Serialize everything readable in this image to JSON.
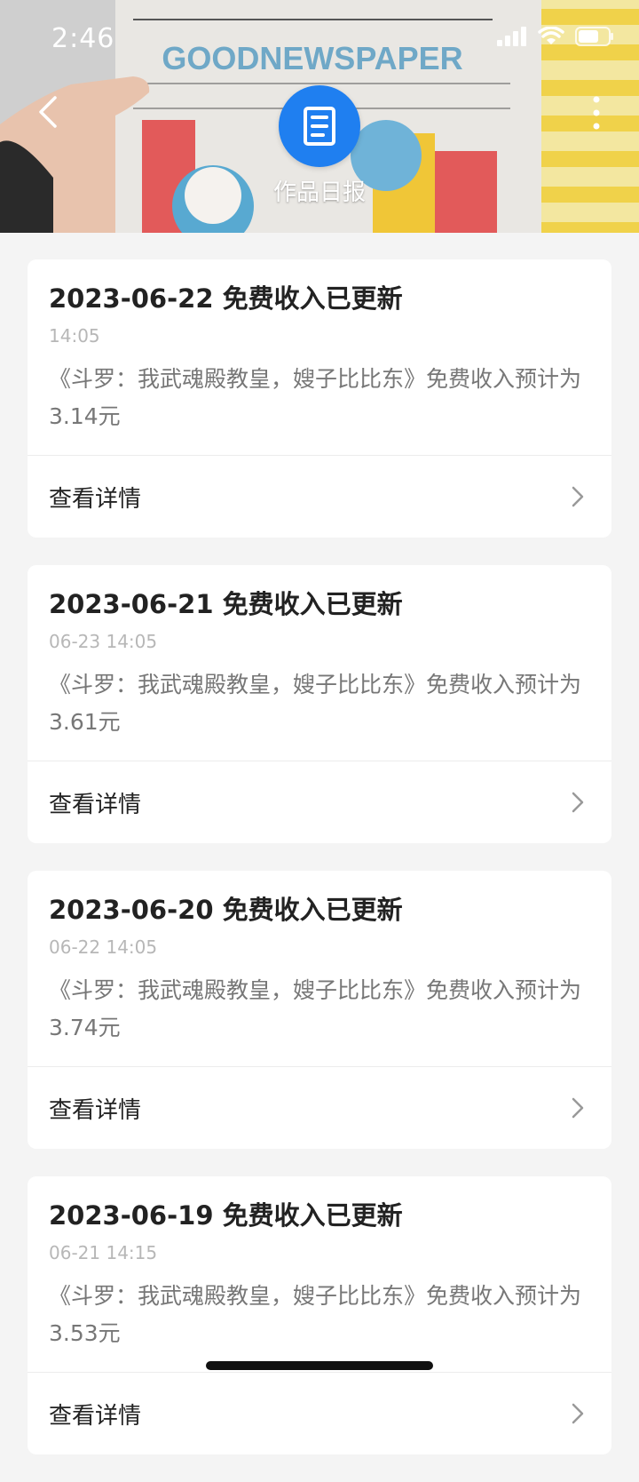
{
  "status": {
    "time": "2:46"
  },
  "header": {
    "banner_text": "GOODNEWSPAPER",
    "title": "作品日报"
  },
  "cards": [
    {
      "title": "2023-06-22 免费收入已更新",
      "time": "14:05",
      "desc": "《斗罗：我武魂殿教皇，嫂子比比东》免费收入预计为3.14元",
      "action": "查看详情"
    },
    {
      "title": "2023-06-21 免费收入已更新",
      "time": "06-23 14:05",
      "desc": "《斗罗：我武魂殿教皇，嫂子比比东》免费收入预计为3.61元",
      "action": "查看详情"
    },
    {
      "title": "2023-06-20 免费收入已更新",
      "time": "06-22 14:05",
      "desc": "《斗罗：我武魂殿教皇，嫂子比比东》免费收入预计为3.74元",
      "action": "查看详情"
    },
    {
      "title": "2023-06-19 免费收入已更新",
      "time": "06-21 14:15",
      "desc": "《斗罗：我武魂殿教皇，嫂子比比东》免费收入预计为3.53元",
      "action": "查看详情"
    }
  ],
  "colors": {
    "accent": "#1f7ff0",
    "background": "#f4f4f4"
  }
}
